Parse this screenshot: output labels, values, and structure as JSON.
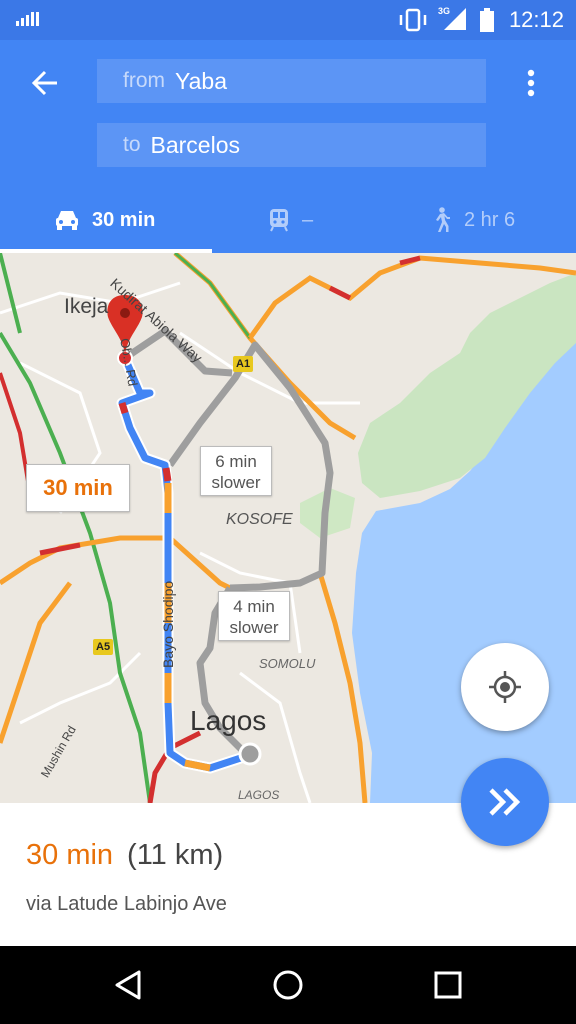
{
  "status_bar": {
    "time": "12:12",
    "network": "3G"
  },
  "search": {
    "from_prefix": "from",
    "from_value": "Yaba",
    "to_prefix": "to",
    "to_value": "Barcelos"
  },
  "modes": [
    {
      "name": "drive",
      "label": "30 min",
      "selected": true
    },
    {
      "name": "transit",
      "label": "–",
      "selected": false
    },
    {
      "name": "walk",
      "label": "2 hr 6",
      "selected": false
    }
  ],
  "map": {
    "labels": {
      "ikeja": "Ikeja",
      "kudirat": "Kudirat Abiola Way",
      "obafemi": "Ob... Rd",
      "kosofe": "KOSOFE",
      "bayo": "Bayo Shodipo",
      "somolu": "SOMOLU",
      "lagos_city": "Lagos",
      "lagos_small": "LAGOS",
      "mushin": "Mushin Rd",
      "a1": "A1",
      "a5": "A5"
    },
    "callouts": {
      "main": "30 min",
      "alt1_time": "6 min",
      "alt1_note": "slower",
      "alt2_time": "4 min",
      "alt2_note": "slower"
    }
  },
  "route_summary": {
    "duration": "30 min",
    "distance": "(11 km)",
    "via": "via Latude Labinjo Ave"
  },
  "colors": {
    "header": "#4285f4",
    "status_bar": "#3b78e7",
    "route": "#4285f4",
    "duration": "#e8710a"
  }
}
